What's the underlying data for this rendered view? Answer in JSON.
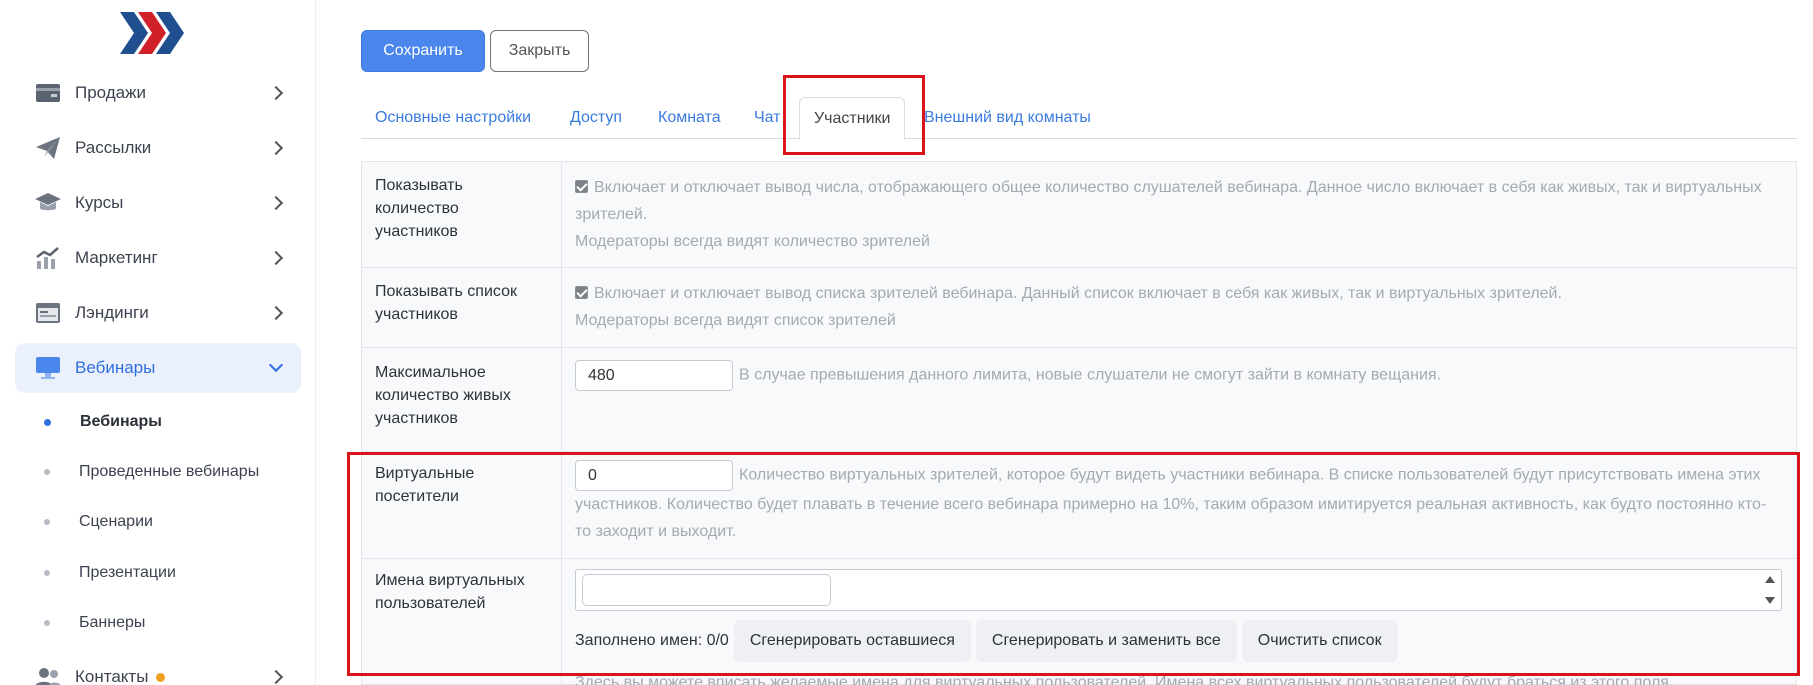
{
  "sidebar": {
    "items": [
      {
        "label": "Продажи",
        "icon": "wallet-icon"
      },
      {
        "label": "Рассылки",
        "icon": "paper-plane-icon"
      },
      {
        "label": "Курсы",
        "icon": "graduation-cap-icon"
      },
      {
        "label": "Маркетинг",
        "icon": "growth-chart-icon"
      },
      {
        "label": "Лэндинги",
        "icon": "landing-page-icon"
      },
      {
        "label": "Вебинары",
        "icon": "monitor-icon"
      },
      {
        "label": "Контакты",
        "icon": "users-icon"
      }
    ],
    "subitems": [
      "Вебинары",
      "Проведенные вебинары",
      "Сценарии",
      "Презентации",
      "Баннеры"
    ]
  },
  "toolbar": {
    "save_label": "Сохранить",
    "close_label": "Закрыть"
  },
  "tabs": [
    "Основные настройки",
    "Доступ",
    "Комната",
    "Чат",
    "Участники",
    "Внешний вид комнаты"
  ],
  "active_tab": "Участники",
  "form": {
    "show_count": {
      "label": "Показывать количество участников",
      "checked": true,
      "description": "Включает и отключает вывод числа, отображающего общее количество слушателей вебинара. Данное число включает в себя как живых, так и виртуальных зрителей.",
      "note": "Модераторы всегда видят количество зрителей"
    },
    "show_list": {
      "label": "Показывать список участников",
      "checked": true,
      "description": "Включает и отключает вывод списка зрителей вебинара. Данный список включает в себя как живых, так и виртуальных зрителей.",
      "note": "Модераторы всегда видят список зрителей"
    },
    "max_live": {
      "label": "Максимальное количество живых участников",
      "value": "480",
      "description": "В случае превышения данного лимита, новые слушатели не смогут зайти в комнату вещания."
    },
    "virtual_visitors": {
      "label": "Виртуальные посетители",
      "value": "0",
      "description": "Количество виртуальных зрителей, которое будут видеть участники вебинара. В списке пользователей будут присутствовать имена этих участников. Количество будет плавать в течение всего вебинара примерно на 10%, таким образом имитируется реальная активность, как будто постоянно кто-то заходит и выходит."
    },
    "virtual_names": {
      "label": "Имена виртуальных пользователей",
      "filled": "Заполнено имен: 0/0",
      "gen_remaining": "Сгенерировать оставшиеся",
      "gen_replace": "Сгенерировать и заменить все",
      "clear": "Очистить список",
      "hint": "Здесь вы можете вписать желаемые имена для виртуальных пользователей. Имена всех виртуальных пользователей будут браться из этого поля"
    }
  },
  "colors": {
    "accent": "#4a86ec",
    "link": "#3a7be0",
    "highlight": "#d9151b",
    "logo_blue": "#1f4f8f",
    "logo_red": "#d0202a",
    "status_dot": "#f0a020"
  }
}
